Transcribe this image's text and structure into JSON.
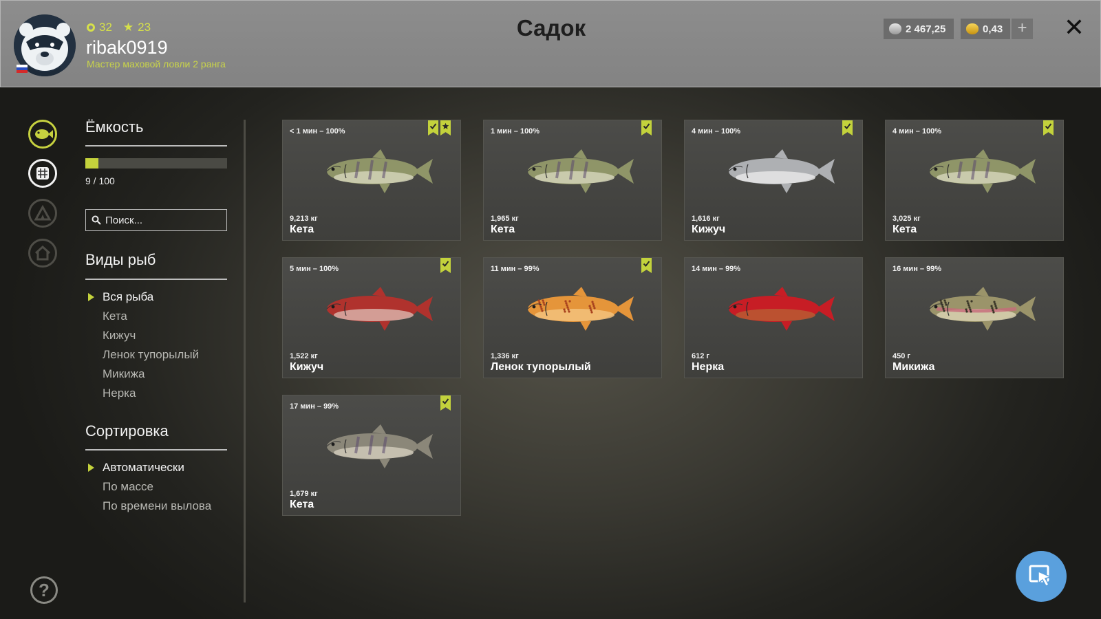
{
  "header": {
    "title": "Садок",
    "rank": "32",
    "stars": "23",
    "username": "ribak0919",
    "user_title": "Мастер маховой ловли 2 ранга",
    "silver": "2 467,25",
    "gold": "0,43",
    "plus_label": "+",
    "close_label": "✕"
  },
  "capacity": {
    "heading": "Ёмкость",
    "text": "9 / 100",
    "fraction": 0.09
  },
  "search": {
    "placeholder": "Поиск..."
  },
  "species": {
    "heading": "Виды рыб",
    "items": [
      "Вся рыба",
      "Кета",
      "Кижуч",
      "Ленок тупорылый",
      "Микижа",
      "Нерка"
    ]
  },
  "sort": {
    "heading": "Сортировка",
    "items": [
      "Автоматически",
      "По массе",
      "По времени вылова"
    ]
  },
  "help_label": "?",
  "fish": [
    {
      "time": "< 1 мин – 100%",
      "weight": "9,213 кг",
      "name": "Кета",
      "kind": "keta",
      "tags": [
        "check",
        "star"
      ]
    },
    {
      "time": "1 мин – 100%",
      "weight": "1,965 кг",
      "name": "Кета",
      "kind": "keta",
      "tags": [
        "check"
      ]
    },
    {
      "time": "4 мин – 100%",
      "weight": "1,616 кг",
      "name": "Кижуч",
      "kind": "silver",
      "tags": [
        "check"
      ]
    },
    {
      "time": "4 мин – 100%",
      "weight": "3,025 кг",
      "name": "Кета",
      "kind": "keta",
      "tags": [
        "check"
      ]
    },
    {
      "time": "5 мин – 100%",
      "weight": "1,522 кг",
      "name": "Кижуч",
      "kind": "red",
      "tags": [
        "check"
      ]
    },
    {
      "time": "11 мин – 99%",
      "weight": "1,336 кг",
      "name": "Ленок тупорылый",
      "kind": "lenok",
      "tags": [
        "check"
      ]
    },
    {
      "time": "14 мин – 99%",
      "weight": "612 г",
      "name": "Нерка",
      "kind": "nerka",
      "tags": []
    },
    {
      "time": "16 мин – 99%",
      "weight": "450 г",
      "name": "Микижа",
      "kind": "trout",
      "tags": []
    },
    {
      "time": "17 мин – 99%",
      "weight": "1,679 кг",
      "name": "Кета",
      "kind": "keta2",
      "tags": [
        "check"
      ]
    }
  ],
  "colors": {
    "accent": "#c4d23c",
    "keta": "#8f9568",
    "keta_belly": "#d4d4b8",
    "silver": "#aeb0b3",
    "silver_belly": "#e6e6e6",
    "red": "#b0322d",
    "red_belly": "#d9b0a8",
    "lenok": "#e5953a",
    "lenok_belly": "#f3c27c",
    "nerka": "#c71d25",
    "nerka_belly": "#b85a33",
    "trout": "#9b946a",
    "trout_belly": "#d9d1b0",
    "keta2": "#8b8779",
    "keta2_belly": "#cfc9b8"
  }
}
